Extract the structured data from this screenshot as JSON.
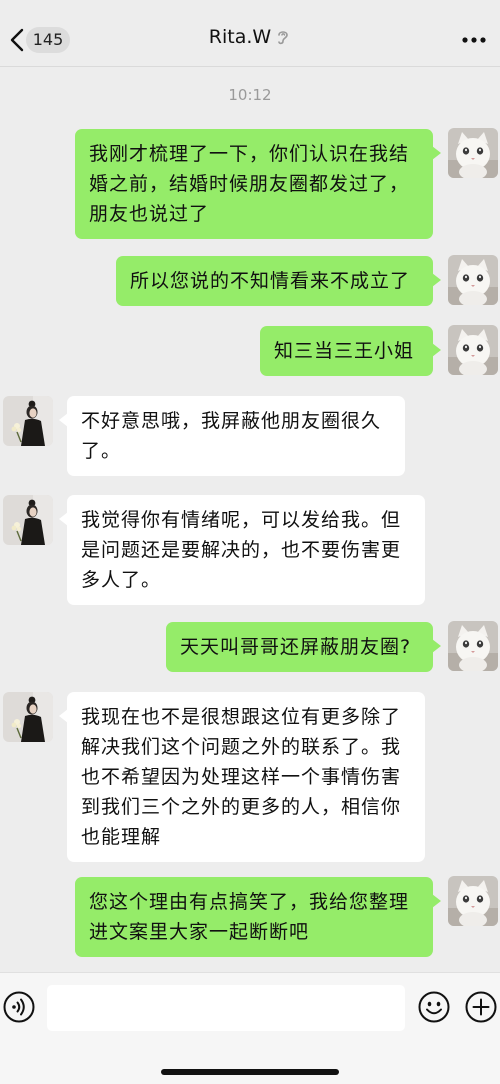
{
  "header": {
    "unread_count": "145",
    "title": "Rita.W"
  },
  "time_label": "10:12",
  "messages": [
    {
      "side": "right",
      "text": "我刚才梳理了一下，你们认识在我结婚之前，结婚时候朋友圈都发过了，朋友也说过了"
    },
    {
      "side": "right",
      "text": "所以您说的不知情看来不成立了"
    },
    {
      "side": "right",
      "text": "知三当三王小姐"
    },
    {
      "side": "left",
      "text": "不好意思哦，我屏蔽他朋友圈很久了。"
    },
    {
      "side": "left",
      "text": "我觉得你有情绪呢，可以发给我。但是问题还是要解决的，也不要伤害更多人了。"
    },
    {
      "side": "right",
      "text": "天天叫哥哥还屏蔽朋友圈?"
    },
    {
      "side": "left",
      "text": "我现在也不是很想跟这位有更多除了解决我们这个问题之外的联系了。我也不希望因为处理这样一个事情伤害到我们三个之外的更多的人，相信你也能理解"
    },
    {
      "side": "right",
      "text": "您这个理由有点搞笑了，我给您整理进文案里大家一起断断吧"
    }
  ],
  "colors": {
    "sent_bubble": "#95ec69",
    "received_bubble": "#ffffff",
    "background": "#ededed"
  },
  "icons": {
    "back": "chevron-left-icon",
    "earpiece": "ear-icon",
    "more": "more-dots-icon",
    "voice": "voice-icon",
    "emoji": "emoji-icon",
    "plus": "plus-icon"
  }
}
